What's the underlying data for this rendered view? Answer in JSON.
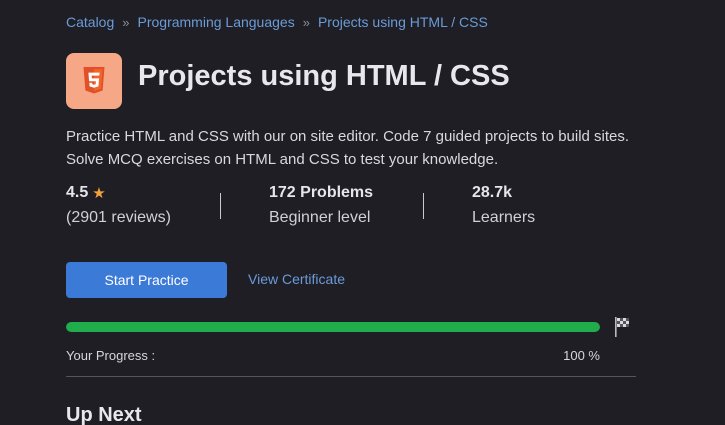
{
  "breadcrumb": {
    "items": [
      "Catalog",
      "Programming Languages",
      "Projects using HTML / CSS"
    ],
    "separator": "»"
  },
  "logo": {
    "icon": "html5-icon",
    "color": "#f6a886"
  },
  "title": "Projects using HTML / CSS",
  "description": "Practice HTML and CSS with our on site editor. Code 7 guided projects to build sites. Solve MCQ exercises on HTML and CSS to test your knowledge.",
  "stats": {
    "rating": {
      "value": "4.5",
      "icon": "star-icon",
      "reviews": "(2901 reviews)"
    },
    "problems": {
      "value": "172 Problems",
      "level": "Beginner level"
    },
    "learners": {
      "value": "28.7k",
      "label": "Learners"
    }
  },
  "actions": {
    "start_label": "Start Practice",
    "certificate_label": "View Certificate"
  },
  "progress": {
    "label": "Your Progress :",
    "value_text": "100 %",
    "percent": 100,
    "icon": "finish-flag-icon",
    "color": "#1fae4b"
  },
  "up_next": {
    "heading": "Up Next"
  },
  "colors": {
    "background": "#1e1e24",
    "accent": "#3c7ad8",
    "link": "#6b9bd8",
    "star": "#f2a33a"
  }
}
